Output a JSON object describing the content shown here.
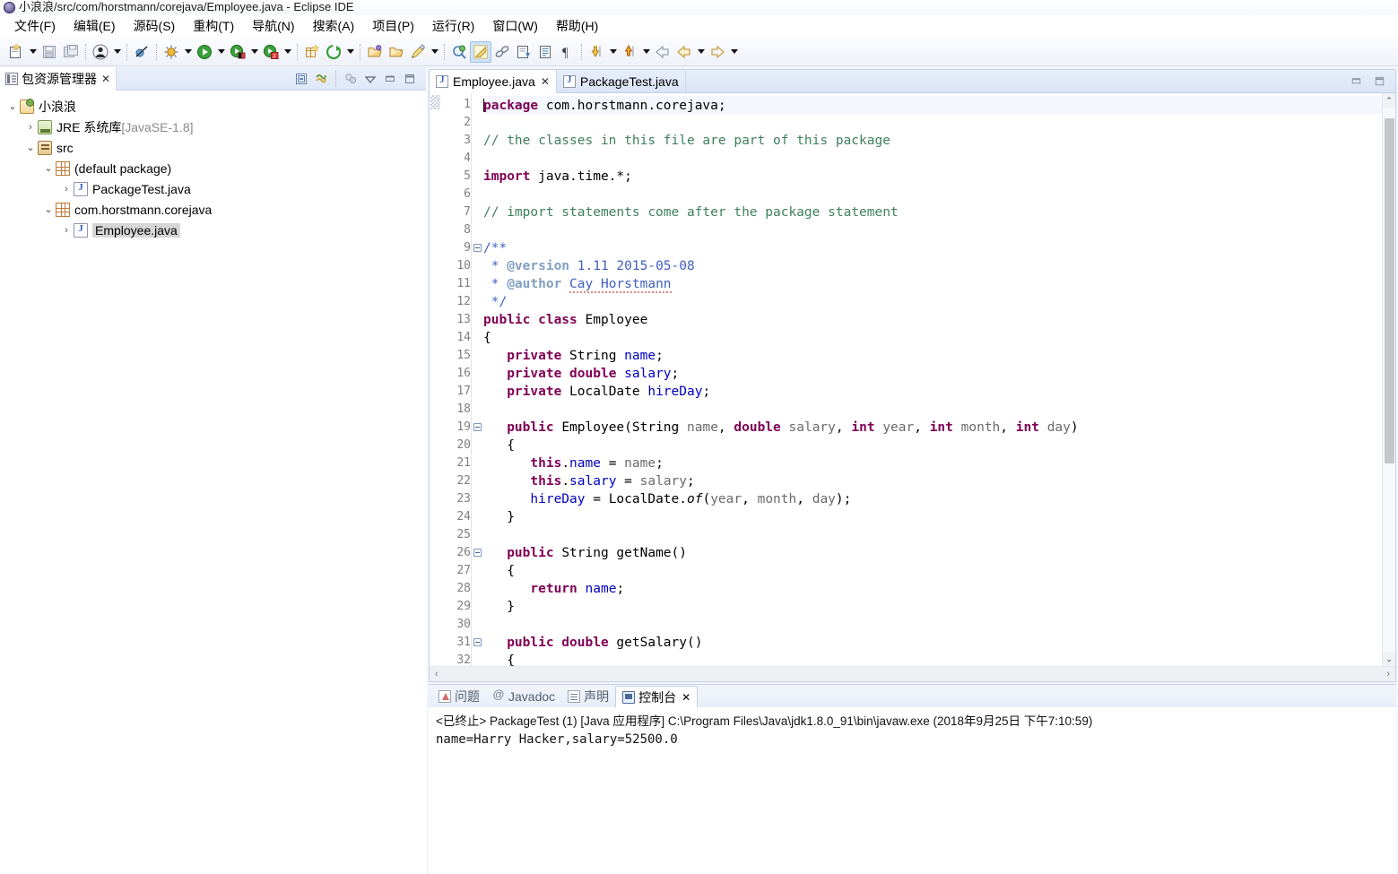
{
  "window": {
    "title": "小浪浪/src/com/horstmann/corejava/Employee.java - Eclipse IDE",
    "app_icon": "eclipse-icon"
  },
  "menubar": {
    "items": [
      {
        "label": "文件(F)",
        "name": "menu-file"
      },
      {
        "label": "编辑(E)",
        "name": "menu-edit"
      },
      {
        "label": "源码(S)",
        "name": "menu-source"
      },
      {
        "label": "重构(T)",
        "name": "menu-refactor"
      },
      {
        "label": "导航(N)",
        "name": "menu-navigate"
      },
      {
        "label": "搜索(A)",
        "name": "menu-search"
      },
      {
        "label": "项目(P)",
        "name": "menu-project"
      },
      {
        "label": "运行(R)",
        "name": "menu-run"
      },
      {
        "label": "窗口(W)",
        "name": "menu-window"
      },
      {
        "label": "帮助(H)",
        "name": "menu-help"
      }
    ]
  },
  "toolbar": {
    "buttons": [
      "new-wizard-icon",
      "dropdown",
      "save-icon",
      "save-all-icon",
      "separator",
      "user-icon",
      "dropdown",
      "separator",
      "skip-breakpoints-icon",
      "separator",
      "debug-icon",
      "dropdown",
      "run-icon",
      "dropdown",
      "run-external-tools-icon",
      "dropdown",
      "coverage-icon",
      "dropdown",
      "separator",
      "new-java-project-icon",
      "new-java-class-icon",
      "dropdown",
      "separator",
      "open-type-icon",
      "open-task-icon",
      "dropdown",
      "separator",
      "search-icon",
      "toggle-mark-occurrences-icon",
      "link-icon",
      "next-annotation-icon",
      "show-whitespace-icon",
      "separator",
      "previous-edit-icon",
      "dropdown",
      "next-edit-icon",
      "dropdown",
      "back-icon",
      "forward-icon",
      "dropdown",
      "forward-arrow-icon",
      "dropdown"
    ]
  },
  "explorer": {
    "view_title": "包资源管理器",
    "view_icon": "package-explorer-icon",
    "close_label": "✕",
    "tools": [
      "collapse-all-icon",
      "link-with-editor-icon",
      "filter-icon",
      "view-menu-icon",
      "minimize-icon",
      "maximize-icon"
    ],
    "tree": [
      {
        "label": "小浪浪",
        "suffix": "",
        "depth": 0,
        "twisty": "v",
        "icon": "ic-proj",
        "icon_name": "java-project-icon",
        "selected": false
      },
      {
        "label": "JRE 系统库",
        "suffix": " [JavaSE-1.8]",
        "depth": 1,
        "twisty": ">",
        "icon": "ic-jre",
        "icon_name": "jre-library-icon",
        "selected": false
      },
      {
        "label": "src",
        "suffix": "",
        "depth": 1,
        "twisty": "v",
        "icon": "ic-src",
        "icon_name": "source-folder-icon",
        "selected": false
      },
      {
        "label": "(default package)",
        "suffix": "",
        "depth": 2,
        "twisty": "v",
        "icon": "ic-pkg",
        "icon_name": "package-icon",
        "selected": false
      },
      {
        "label": "PackageTest.java",
        "suffix": "",
        "depth": 3,
        "twisty": ">",
        "icon": "ic-java",
        "icon_name": "java-file-icon",
        "selected": false
      },
      {
        "label": "com.horstmann.corejava",
        "suffix": "",
        "depth": 2,
        "twisty": "v",
        "icon": "ic-pkg",
        "icon_name": "package-icon",
        "selected": false
      },
      {
        "label": "Employee.java",
        "suffix": "",
        "depth": 3,
        "twisty": ">",
        "icon": "ic-java",
        "icon_name": "java-file-icon",
        "selected": true
      }
    ]
  },
  "editor": {
    "tabs": [
      {
        "label": "Employee.java",
        "active": true,
        "closable": true
      },
      {
        "label": "PackageTest.java",
        "active": false,
        "closable": false
      }
    ],
    "close_glyph": "✕",
    "window_buttons": [
      "minimize-icon",
      "maximize-icon"
    ],
    "first_line": 1,
    "last_line": 32,
    "fold_lines": [
      9,
      19,
      26,
      31
    ],
    "scroll": {
      "up_glyph": "⌃",
      "down_glyph": "⌄",
      "left_glyph": "‹",
      "right_glyph": "›"
    },
    "lines": [
      {
        "n": 1,
        "cur": true,
        "tokens": [
          {
            "t": "caret",
            "v": ""
          },
          {
            "t": "kw",
            "v": "package"
          },
          {
            "t": "pl",
            "v": " com.horstmann.corejava;"
          }
        ]
      },
      {
        "n": 2,
        "tokens": []
      },
      {
        "n": 3,
        "tokens": [
          {
            "t": "cm",
            "v": "// the classes in this file are part of this package"
          }
        ]
      },
      {
        "n": 4,
        "tokens": []
      },
      {
        "n": 5,
        "tokens": [
          {
            "t": "kw",
            "v": "import"
          },
          {
            "t": "pl",
            "v": " java.time.*;"
          }
        ]
      },
      {
        "n": 6,
        "tokens": []
      },
      {
        "n": 7,
        "tokens": [
          {
            "t": "cm",
            "v": "// import statements come after the package statement"
          }
        ]
      },
      {
        "n": 8,
        "tokens": []
      },
      {
        "n": 9,
        "tokens": [
          {
            "t": "jd",
            "v": "/**"
          }
        ]
      },
      {
        "n": 10,
        "tokens": [
          {
            "t": "jd",
            "v": " * "
          },
          {
            "t": "jdt",
            "v": "@version"
          },
          {
            "t": "jd",
            "v": " 1.11 2015-05-08"
          }
        ]
      },
      {
        "n": 11,
        "tokens": [
          {
            "t": "jd",
            "v": " * "
          },
          {
            "t": "jdt",
            "v": "@author"
          },
          {
            "t": "jd",
            "v": " "
          },
          {
            "t": "jdspell",
            "v": "Cay Horstmann"
          }
        ]
      },
      {
        "n": 12,
        "tokens": [
          {
            "t": "jd",
            "v": " */"
          }
        ]
      },
      {
        "n": 13,
        "tokens": [
          {
            "t": "kw",
            "v": "public class"
          },
          {
            "t": "pl",
            "v": " Employee"
          }
        ]
      },
      {
        "n": 14,
        "tokens": [
          {
            "t": "pl",
            "v": "{"
          }
        ]
      },
      {
        "n": 15,
        "tokens": [
          {
            "t": "pl",
            "v": "   "
          },
          {
            "t": "kw",
            "v": "private"
          },
          {
            "t": "pl",
            "v": " String "
          },
          {
            "t": "fld",
            "v": "name"
          },
          {
            "t": "pl",
            "v": ";"
          }
        ]
      },
      {
        "n": 16,
        "tokens": [
          {
            "t": "pl",
            "v": "   "
          },
          {
            "t": "kw",
            "v": "private double"
          },
          {
            "t": "pl",
            "v": " "
          },
          {
            "t": "fld",
            "v": "salary"
          },
          {
            "t": "pl",
            "v": ";"
          }
        ]
      },
      {
        "n": 17,
        "tokens": [
          {
            "t": "pl",
            "v": "   "
          },
          {
            "t": "kw",
            "v": "private"
          },
          {
            "t": "pl",
            "v": " LocalDate "
          },
          {
            "t": "fld",
            "v": "hireDay"
          },
          {
            "t": "pl",
            "v": ";"
          }
        ]
      },
      {
        "n": 18,
        "tokens": []
      },
      {
        "n": 19,
        "tokens": [
          {
            "t": "pl",
            "v": "   "
          },
          {
            "t": "kw",
            "v": "public"
          },
          {
            "t": "pl",
            "v": " Employee(String "
          },
          {
            "t": "par",
            "v": "name"
          },
          {
            "t": "pl",
            "v": ", "
          },
          {
            "t": "kw",
            "v": "double"
          },
          {
            "t": "pl",
            "v": " "
          },
          {
            "t": "par",
            "v": "salary"
          },
          {
            "t": "pl",
            "v": ", "
          },
          {
            "t": "kw",
            "v": "int"
          },
          {
            "t": "pl",
            "v": " "
          },
          {
            "t": "par",
            "v": "year"
          },
          {
            "t": "pl",
            "v": ", "
          },
          {
            "t": "kw",
            "v": "int"
          },
          {
            "t": "pl",
            "v": " "
          },
          {
            "t": "par",
            "v": "month"
          },
          {
            "t": "pl",
            "v": ", "
          },
          {
            "t": "kw",
            "v": "int"
          },
          {
            "t": "pl",
            "v": " "
          },
          {
            "t": "par",
            "v": "day"
          },
          {
            "t": "pl",
            "v": ")"
          }
        ]
      },
      {
        "n": 20,
        "tokens": [
          {
            "t": "pl",
            "v": "   {"
          }
        ]
      },
      {
        "n": 21,
        "tokens": [
          {
            "t": "pl",
            "v": "      "
          },
          {
            "t": "kw",
            "v": "this"
          },
          {
            "t": "pl",
            "v": "."
          },
          {
            "t": "fld",
            "v": "name"
          },
          {
            "t": "pl",
            "v": " = "
          },
          {
            "t": "par",
            "v": "name"
          },
          {
            "t": "pl",
            "v": ";"
          }
        ]
      },
      {
        "n": 22,
        "tokens": [
          {
            "t": "pl",
            "v": "      "
          },
          {
            "t": "kw",
            "v": "this"
          },
          {
            "t": "pl",
            "v": "."
          },
          {
            "t": "fld",
            "v": "salary"
          },
          {
            "t": "pl",
            "v": " = "
          },
          {
            "t": "par",
            "v": "salary"
          },
          {
            "t": "pl",
            "v": ";"
          }
        ]
      },
      {
        "n": 23,
        "tokens": [
          {
            "t": "pl",
            "v": "      "
          },
          {
            "t": "fld",
            "v": "hireDay"
          },
          {
            "t": "pl",
            "v": " = LocalDate."
          },
          {
            "t": "it",
            "v": "of"
          },
          {
            "t": "pl",
            "v": "("
          },
          {
            "t": "par",
            "v": "year"
          },
          {
            "t": "pl",
            "v": ", "
          },
          {
            "t": "par",
            "v": "month"
          },
          {
            "t": "pl",
            "v": ", "
          },
          {
            "t": "par",
            "v": "day"
          },
          {
            "t": "pl",
            "v": ");"
          }
        ]
      },
      {
        "n": 24,
        "tokens": [
          {
            "t": "pl",
            "v": "   }"
          }
        ]
      },
      {
        "n": 25,
        "tokens": []
      },
      {
        "n": 26,
        "tokens": [
          {
            "t": "pl",
            "v": "   "
          },
          {
            "t": "kw",
            "v": "public"
          },
          {
            "t": "pl",
            "v": " String getName()"
          }
        ]
      },
      {
        "n": 27,
        "tokens": [
          {
            "t": "pl",
            "v": "   {"
          }
        ]
      },
      {
        "n": 28,
        "tokens": [
          {
            "t": "pl",
            "v": "      "
          },
          {
            "t": "kw",
            "v": "return"
          },
          {
            "t": "pl",
            "v": " "
          },
          {
            "t": "fld",
            "v": "name"
          },
          {
            "t": "pl",
            "v": ";"
          }
        ]
      },
      {
        "n": 29,
        "tokens": [
          {
            "t": "pl",
            "v": "   }"
          }
        ]
      },
      {
        "n": 30,
        "tokens": []
      },
      {
        "n": 31,
        "tokens": [
          {
            "t": "pl",
            "v": "   "
          },
          {
            "t": "kw",
            "v": "public double"
          },
          {
            "t": "pl",
            "v": " getSalary()"
          }
        ]
      },
      {
        "n": 32,
        "tokens": [
          {
            "t": "pl",
            "v": "   {"
          }
        ]
      }
    ]
  },
  "console": {
    "tabs": [
      {
        "label": "问题",
        "icon": "ic-problems",
        "icon_name": "problems-icon",
        "active": false
      },
      {
        "label": "Javadoc",
        "icon": "ic-javadoc",
        "icon_name": "javadoc-icon",
        "active": false
      },
      {
        "label": "声明",
        "icon": "ic-declaration",
        "icon_name": "declaration-icon",
        "active": false
      },
      {
        "label": "控制台",
        "icon": "ic-console",
        "icon_name": "console-icon",
        "active": true
      }
    ],
    "close_glyph": "✕",
    "launch_line": "<已终止> PackageTest (1)  [Java 应用程序] C:\\Program Files\\Java\\jdk1.8.0_91\\bin\\javaw.exe  (2018年9月25日 下午7:10:59)",
    "output": "name=Harry Hacker,salary=52500.0"
  },
  "colors": {
    "keyword": "#7F0055",
    "comment": "#3F7F5F",
    "javadoc": "#3F5FBF",
    "javadoc_tag": "#7F9FBF",
    "field": "#0000C0",
    "parameter": "#6A6A6A",
    "selection": "#D6D6D6",
    "tab_active_bg": "#FFFFFF",
    "chrome_bg": "#E8EEF8"
  }
}
